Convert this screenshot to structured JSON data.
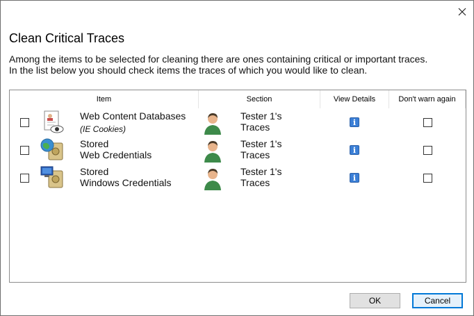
{
  "dialog": {
    "title": "Clean Critical Traces",
    "description_line1": "Among the items to be selected for cleaning there are ones containing critical or important traces.",
    "description_line2": "In the list below you should check items the traces of which you would like to clean."
  },
  "columns": {
    "item": "Item",
    "section": "Section",
    "view_details": "View Details",
    "dont_warn": "Don't warn again"
  },
  "rows": [
    {
      "item_line1": "Web Content Databases",
      "item_line2": "(IE Cookies)",
      "section_line1": "Tester 1's",
      "section_line2": "Traces",
      "icon": "cookie-database-icon"
    },
    {
      "item_line1": "Stored",
      "item_line2": "Web Credentials",
      "section_line1": "Tester 1's",
      "section_line2": "Traces",
      "icon": "web-credentials-vault-icon"
    },
    {
      "item_line1": "Stored",
      "item_line2": "Windows Credentials",
      "section_line1": "Tester 1's",
      "section_line2": "Traces",
      "icon": "windows-credentials-vault-icon"
    }
  ],
  "buttons": {
    "ok": "OK",
    "cancel": "Cancel"
  },
  "colors": {
    "accent": "#0078d7",
    "info_icon": "#3b7fd6"
  }
}
